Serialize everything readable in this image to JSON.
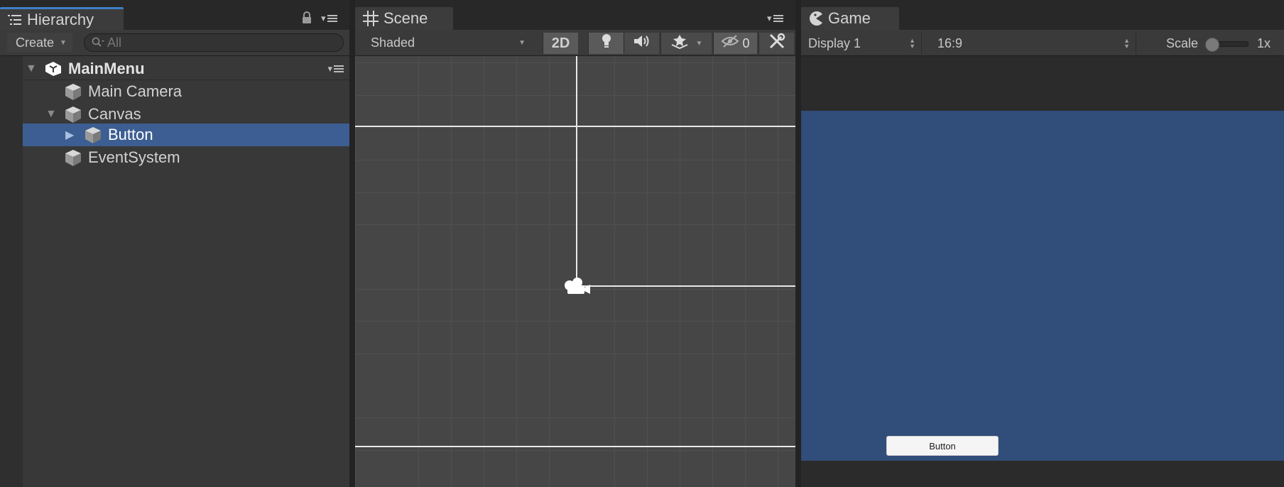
{
  "hierarchy": {
    "tab_label": "Hierarchy",
    "create_label": "Create",
    "search_placeholder": "All",
    "scene_name": "MainMenu",
    "items": [
      {
        "label": "Main Camera"
      },
      {
        "label": "Canvas"
      },
      {
        "label": "Button"
      },
      {
        "label": "EventSystem"
      }
    ]
  },
  "scene": {
    "tab_label": "Scene",
    "draw_mode": "Shaded",
    "mode_2d": "2D",
    "hidden_count": "0"
  },
  "game": {
    "tab_label": "Game",
    "display": "Display 1",
    "aspect": "16:9",
    "scale_label": "Scale",
    "scale_value": "1x",
    "ui_button_label": "Button"
  },
  "colors": {
    "selection": "#3c5e92",
    "game_background": "#314d79",
    "active_tab_accent": "#3e7fc8"
  },
  "icons": [
    "hierarchy-list-icon",
    "lock-icon",
    "panel-menu-icon",
    "unity-logo-icon",
    "gameobject-cube-icon",
    "scene-grid-icon",
    "lighting-icon",
    "audio-icon",
    "effects-icon",
    "scene-visibility-icon",
    "gizmos-tools-icon",
    "game-pacman-icon",
    "camera-gizmo-icon"
  ]
}
